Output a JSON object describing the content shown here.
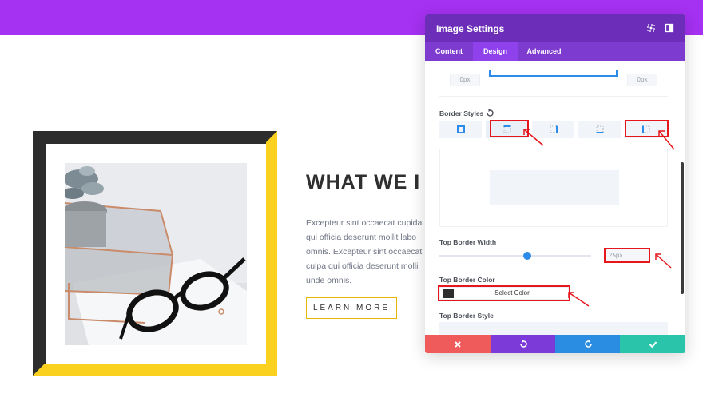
{
  "colors": {
    "top_bar": "#a531f2",
    "panel_header": "#6c2eb9",
    "panel_tabs": "#7e3bd0",
    "active_tab": "#8f42ec",
    "frame_dark": "#2d2d2d",
    "frame_yellow": "#f9d11e",
    "accent_blue": "#2c8ae8",
    "highlight_red": "#e6161d",
    "cancel": "#ef5a5a",
    "undo": "#7c3bd8",
    "redo": "#2a8de2",
    "save": "#29c4a9"
  },
  "content": {
    "heading": "WHAT WE I",
    "paragraph_lines": [
      "Excepteur sint occaecat cupida",
      "qui officia deserunt mollit labo",
      "omnis. Excepteur sint occaecat",
      "culpa qui officia deserunt molli",
      "unde omnis."
    ],
    "cta_label": "LEARN MORE"
  },
  "panel": {
    "title": "Image Settings",
    "header_icons": [
      "fullscreen-icon",
      "split-view-icon"
    ],
    "tabs": [
      "Content",
      "Design",
      "Advanced"
    ],
    "active_tab": "Design",
    "margin_left_value": "0px",
    "margin_right_value": "0px",
    "border_styles_label": "Border Styles",
    "border_style_options": [
      "all-borders-icon",
      "top-border-icon",
      "right-border-icon",
      "bottom-border-icon",
      "left-border-icon"
    ],
    "selected_border_style": "top-border-icon",
    "top_border_width_label": "Top Border Width",
    "top_border_width_value": "25px",
    "top_border_width_slider": 0.58,
    "top_border_color_label": "Top Border Color",
    "select_color_label": "Select Color",
    "top_border_style_label": "Top Border Style",
    "footer_buttons": [
      "cancel-icon",
      "undo-icon",
      "redo-icon",
      "save-icon"
    ]
  }
}
